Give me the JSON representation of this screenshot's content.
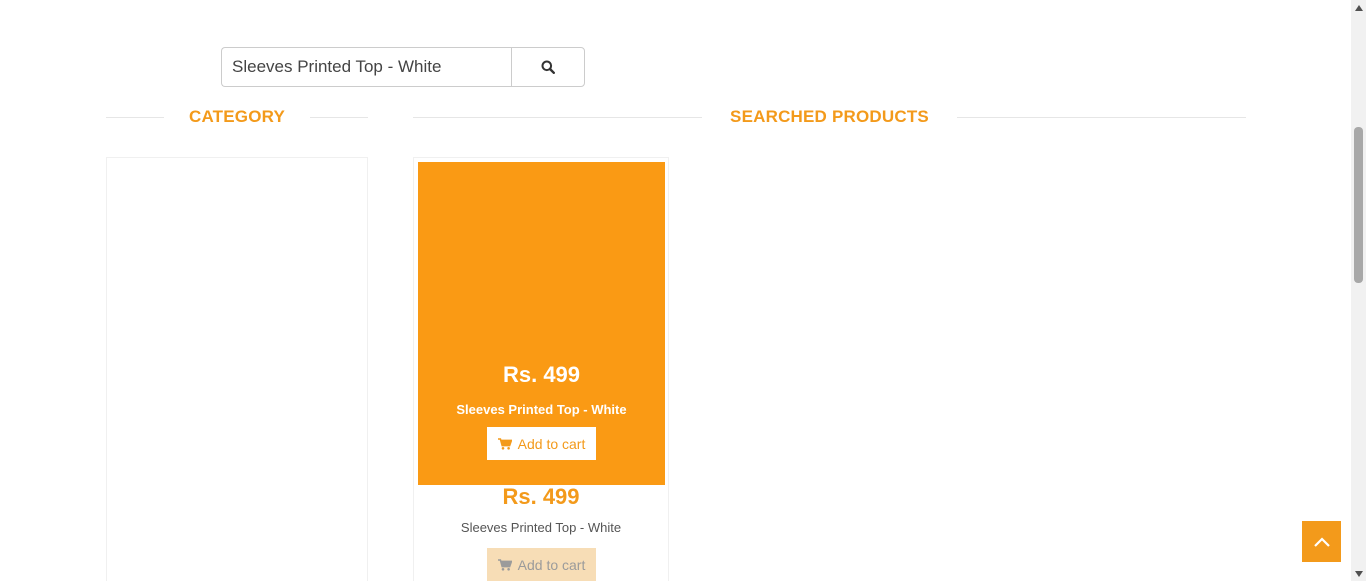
{
  "search": {
    "value": "Sleeves Printed Top - White",
    "icon": "search-icon"
  },
  "sections": {
    "category_title": "CATEGORY",
    "products_title": "SEARCHED PRODUCTS"
  },
  "product": {
    "price": "Rs. 499",
    "name": "Sleeves Printed Top - White",
    "add_to_cart": "Add to cart",
    "cart_icon": "cart-icon"
  },
  "colors": {
    "accent": "#f39a1b",
    "overlay": "#fa9a14"
  },
  "back_to_top_icon": "chevron-up-icon"
}
